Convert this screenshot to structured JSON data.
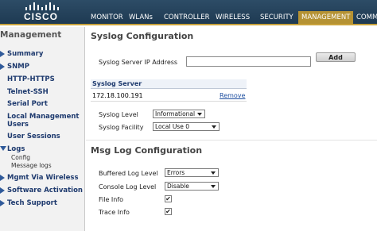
{
  "brand": "CISCO",
  "nav": [
    "MONITOR",
    "WLANs",
    "CONTROLLER",
    "WIRELESS",
    "SECURITY",
    "MANAGEMENT",
    "COMM"
  ],
  "sidebar": {
    "title": "Management",
    "items": [
      "Summary",
      "SNMP",
      "HTTP-HTTPS",
      "Telnet-SSH",
      "Serial Port",
      "Local Management Users",
      "User Sessions",
      "Logs",
      "Mgmt Via Wireless",
      "Software Activation",
      "Tech Support"
    ],
    "logs_sub": [
      "Config",
      "Message logs"
    ]
  },
  "syslog": {
    "title": "Syslog Configuration",
    "ip_label": "Syslog Server IP Address",
    "ip_value": "",
    "add_label": "Add",
    "table_header": "Syslog Server",
    "server": "172.18.100.191",
    "remove_label": "Remove",
    "level_label": "Syslog Level",
    "level_value": "Informational",
    "facility_label": "Syslog Facility",
    "facility_value": "Local Use 0"
  },
  "msglog": {
    "title": "Msg Log Configuration",
    "buffered_label": "Buffered Log Level",
    "buffered_value": "Errors",
    "console_label": "Console Log Level",
    "console_value": "Disable",
    "fileinfo_label": "File Info",
    "fileinfo_checked": true,
    "traceinfo_label": "Trace Info",
    "traceinfo_checked": true
  },
  "colors": {
    "topbar": "#1e3a52",
    "active_tab": "#b59233",
    "link": "#1e4fa0"
  }
}
